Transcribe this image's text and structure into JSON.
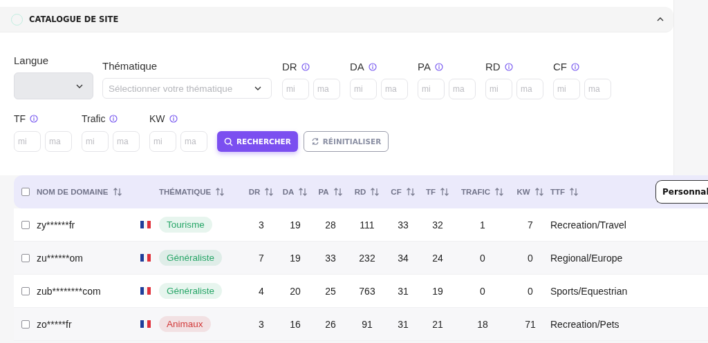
{
  "panel": {
    "title": "CATALOGUE DE SITE",
    "expanded": true
  },
  "filters": {
    "langue": {
      "label": "Langue"
    },
    "thematique": {
      "label": "Thématique",
      "placeholder": "Sélectionner votre thématique"
    },
    "ranges": [
      {
        "label": "DR",
        "min_placeholder": "mi",
        "max_placeholder": "ma"
      },
      {
        "label": "DA",
        "min_placeholder": "mi",
        "max_placeholder": "ma"
      },
      {
        "label": "PA",
        "min_placeholder": "mi",
        "max_placeholder": "ma"
      },
      {
        "label": "RD",
        "min_placeholder": "mi",
        "max_placeholder": "ma"
      },
      {
        "label": "CF",
        "min_placeholder": "mi",
        "max_placeholder": "ma"
      },
      {
        "label": "TF",
        "min_placeholder": "mi",
        "max_placeholder": "ma"
      },
      {
        "label": "Trafic",
        "min_placeholder": "mi",
        "max_placeholder": "ma"
      },
      {
        "label": "KW",
        "min_placeholder": "mi",
        "max_placeholder": "ma"
      }
    ],
    "search_button": "RECHERCHER",
    "reset_button": "RÉINITIALISER"
  },
  "table": {
    "select_all_checked": false,
    "columns": [
      "NOM DE DOMAINE",
      "THÉMATIQUE",
      "DR",
      "DA",
      "PA",
      "RD",
      "CF",
      "TF",
      "TRAFIC",
      "KW",
      "TTF"
    ],
    "customize_button": "Personnal",
    "rows": [
      {
        "checked": false,
        "domain": "zy******fr",
        "tag": "Tourisme",
        "color": "#27a567",
        "dr": "3",
        "da": "19",
        "pa": "28",
        "rd": "111",
        "cf": "33",
        "tf": "32",
        "trafic": "1",
        "kw": "7",
        "ttf": "Recreation/Travel"
      },
      {
        "checked": false,
        "domain": "zu******om",
        "tag": "Généraliste",
        "color": "#27a567",
        "dr": "7",
        "da": "19",
        "pa": "33",
        "rd": "232",
        "cf": "34",
        "tf": "24",
        "trafic": "0",
        "kw": "0",
        "ttf": "Regional/Europe"
      },
      {
        "checked": false,
        "domain": "zub********com",
        "tag": "Généraliste",
        "color": "#27a567",
        "dr": "4",
        "da": "20",
        "pa": "25",
        "rd": "763",
        "cf": "31",
        "tf": "19",
        "trafic": "0",
        "kw": "0",
        "ttf": "Sports/Equestrian"
      },
      {
        "checked": false,
        "domain": "zo*****fr",
        "tag": "Animaux",
        "color": "#d23a3a",
        "dr": "3",
        "da": "16",
        "pa": "26",
        "rd": "91",
        "cf": "31",
        "tf": "21",
        "trafic": "18",
        "kw": "71",
        "ttf": "Recreation/Pets"
      }
    ]
  }
}
